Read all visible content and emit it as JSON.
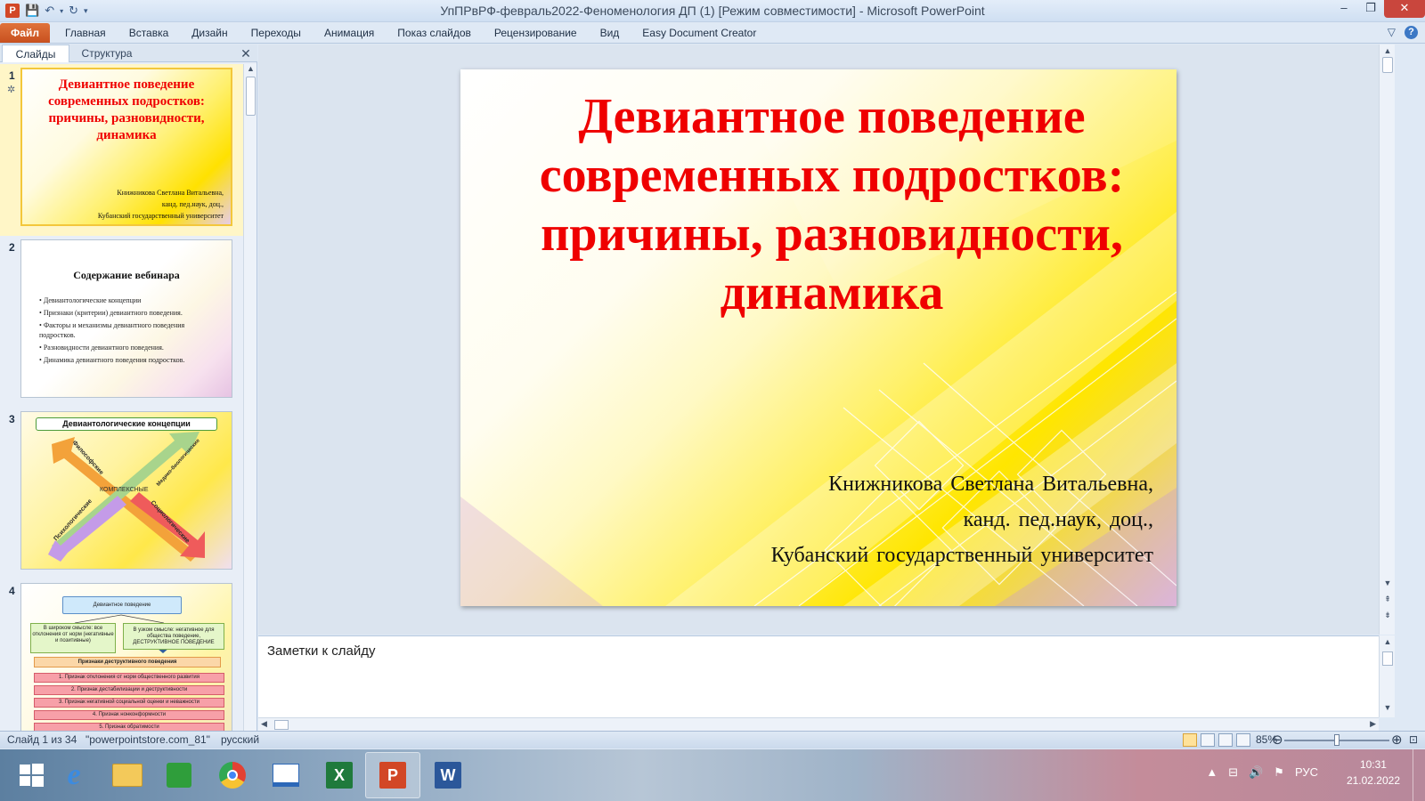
{
  "window": {
    "title": "УпПРвРФ-февраль2022-Феноменология ДП (1) [Режим совместимости]  -  Microsoft PowerPoint",
    "app_icon_letter": "P",
    "minimize": "–",
    "maximize": "❐",
    "close": "✕"
  },
  "ribbon": {
    "file_tab": "Файл",
    "tabs": [
      "Главная",
      "Вставка",
      "Дизайн",
      "Переходы",
      "Анимация",
      "Показ слайдов",
      "Рецензирование",
      "Вид",
      "Easy Document Creator"
    ],
    "help": "?"
  },
  "left_pane": {
    "tab_slides": "Слайды",
    "tab_outline": "Структура",
    "close": "✕"
  },
  "thumbnails": [
    {
      "number": "1",
      "title": "Девиантное поведение современных подростков: причины, разновидности, динамика",
      "author_lines": [
        "Книжникова Светлана Витальевна,",
        "канд. пед.наук, доц.,",
        "Кубанский государственный университет"
      ]
    },
    {
      "number": "2",
      "title": "Содержание вебинара",
      "items": [
        "Девиантологические концепции",
        "Признаки (критерии) девиантного поведения.",
        "Факторы и механизмы девиантного поведения подростков.",
        "Разновидности девиантного поведения.",
        "Динамика девиантного поведения подростков."
      ]
    },
    {
      "number": "3",
      "title": "Девиантологические концепции",
      "labels": [
        "Философские",
        "Медико-биологические",
        "КОМПЛЕКСНЫЕ",
        "Психологические",
        "Социологические"
      ]
    },
    {
      "number": "4",
      "top_box": "Девиантное поведение",
      "left_box": "В широком смысле: все отклонения от норм (негативные и позитивные)",
      "right_box": "В узком смысле: негативное для общества поведение, ДЕСТРУКТИВНОЕ ПОВЕДЕНИЕ",
      "header": "Признаки деструктивного поведения",
      "rows": [
        "1. Признак отклонения от норм общественного развития",
        "2. Признак дестабилизации и деструктивности",
        "3. Признак негативной социальной оценки и неважности",
        "4. Признак нонконформности",
        "5. Признак обратимости"
      ]
    }
  ],
  "slide": {
    "title": "Девиантное поведение современных подростков: причины, разновидности, динамика",
    "author_lines": [
      "Книжникова Светлана Витальевна,",
      "канд. пед.наук, доц.,",
      "Кубанский государственный университет"
    ]
  },
  "notes": {
    "placeholder": "Заметки к слайду"
  },
  "statusbar": {
    "slide_counter": "Слайд 1 из 34",
    "theme": "\"powerpointstore.com_81\"",
    "language": "русский",
    "zoom": "85%",
    "zoom_level": 0.5
  },
  "taskbar": {
    "apps": [
      "start",
      "internet-explorer",
      "file-explorer",
      "store",
      "chrome",
      "scanner",
      "excel",
      "powerpoint",
      "word"
    ],
    "active_app": "powerpoint",
    "tray_lang": "РУС",
    "time": "10:31",
    "date": "21.02.2022"
  },
  "colors": {
    "title_red": "#ef0000",
    "slide_yellow": "#ffe600",
    "file_tab_orange": "#d95f2b"
  }
}
